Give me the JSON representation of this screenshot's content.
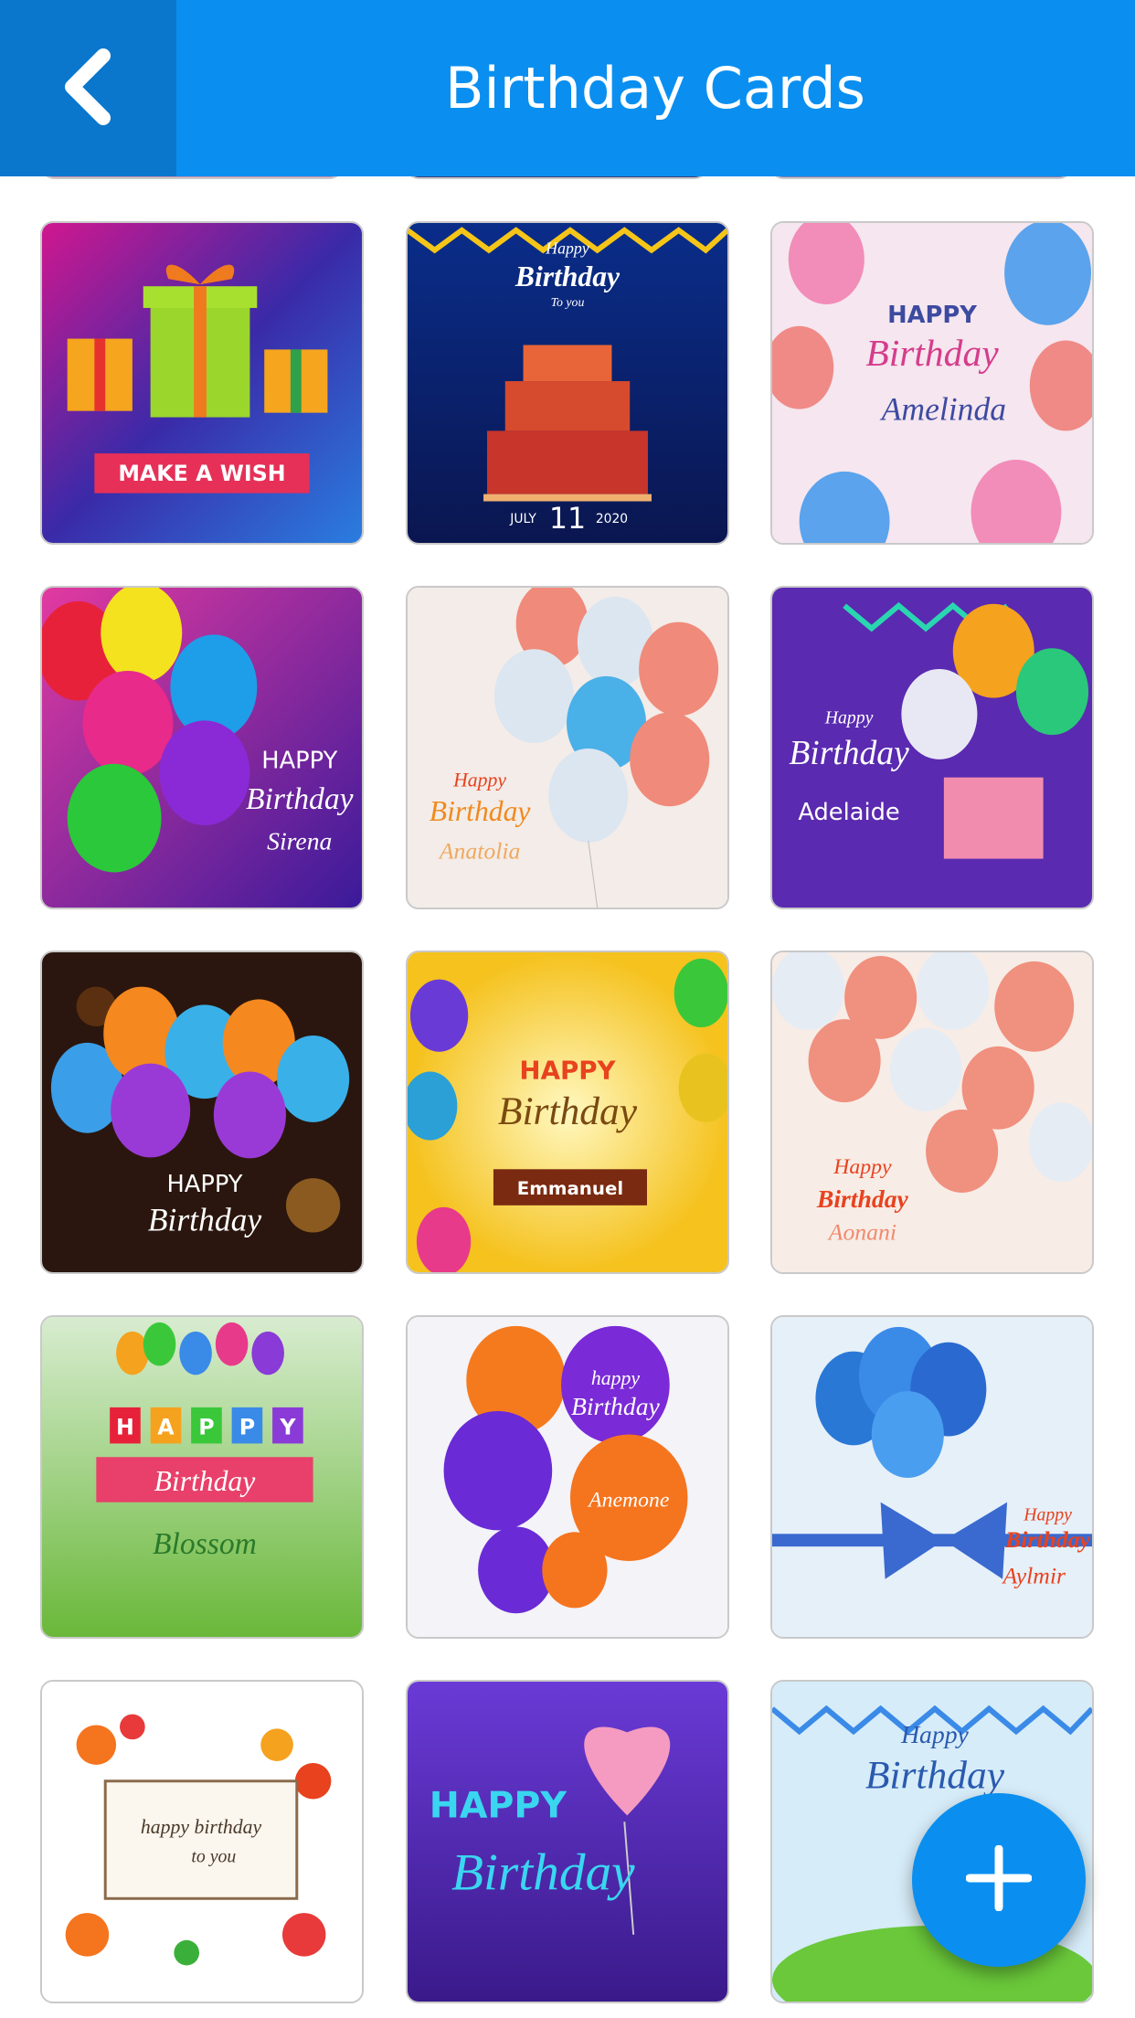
{
  "header": {
    "title": "Birthday Cards",
    "back_icon": "chevron-left-icon"
  },
  "colors": {
    "header": "#0a8ff0",
    "back_button": "#0a77cc",
    "fab": "#0a8ff0"
  },
  "cards": [
    {
      "texts": [
        "MAKE A WISH"
      ]
    },
    {
      "texts": [
        "Happy",
        "Birthday",
        "To you",
        "JULY",
        "11",
        "2020"
      ]
    },
    {
      "texts": [
        "HAPPY",
        "Birthday",
        "Amelinda"
      ]
    },
    {
      "texts": [
        "HAPPY",
        "Birthday",
        "Sirena"
      ]
    },
    {
      "texts": [
        "Happy",
        "Birthday",
        "Anatolia"
      ]
    },
    {
      "texts": [
        "Happy",
        "Birthday",
        "Adelaide"
      ]
    },
    {
      "texts": [
        "HAPPY",
        "Birthday"
      ]
    },
    {
      "texts": [
        "HAPPY",
        "Birthday",
        "Emmanuel"
      ]
    },
    {
      "texts": [
        "Happy",
        "Birthday",
        "Aonani"
      ]
    },
    {
      "texts": [
        "H",
        "A",
        "P",
        "P",
        "Y",
        "Birthday",
        "Blossom"
      ]
    },
    {
      "texts": [
        "happy",
        "Birthday",
        "Anemone"
      ]
    },
    {
      "texts": [
        "Happy",
        "Birthday",
        "Aylmir"
      ]
    },
    {
      "texts": [
        "happy birthday",
        "to you"
      ]
    },
    {
      "texts": [
        "HAPPY",
        "Birthday"
      ]
    },
    {
      "texts": [
        "Happy",
        "Birthday"
      ]
    }
  ],
  "fab": {
    "icon": "plus-icon"
  }
}
